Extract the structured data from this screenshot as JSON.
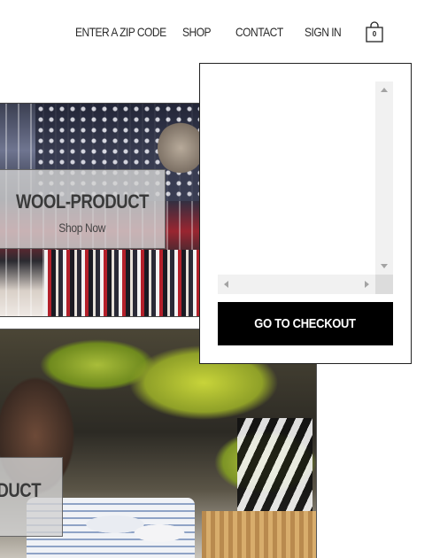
{
  "nav": {
    "zip_label": "ENTER A ZIP CODE",
    "shop_label": "SHOP",
    "contact_label": "CONTACT",
    "signin_label": "SIGN IN",
    "cart_count": "0",
    "cart_icon": "shopping-bag-icon"
  },
  "products": [
    {
      "title": "WOOL-PRODUCT",
      "link_label": "Shop Now"
    },
    {
      "title": "DUCT"
    }
  ],
  "cart_panel": {
    "checkout_label": "GO TO CHECKOUT"
  },
  "colors": {
    "checkout_bg": "#000000",
    "checkout_text": "#ffffff",
    "caption_bg": "#d2d2d2",
    "scrollbar_track": "#f1f1f1"
  }
}
